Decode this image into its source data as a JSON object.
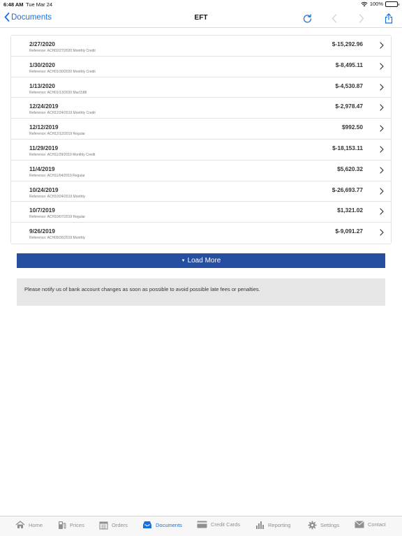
{
  "status": {
    "time": "6:48 AM",
    "date": "Tue Mar 24",
    "battery": "100%"
  },
  "nav": {
    "back_label": "Documents",
    "title": "EFT"
  },
  "rows": [
    {
      "date": "2/27/2020",
      "reference": "Reference: ACH02/27/2020 Monthly Credit",
      "amount": "$-15,292.96"
    },
    {
      "date": "1/30/2020",
      "reference": "Reference: ACH01/30/2020 Monthly Credit",
      "amount": "$-8,495.11"
    },
    {
      "date": "1/13/2020",
      "reference": "Reference: ACH01/13/2020 Mar1588",
      "amount": "$-4,530.87"
    },
    {
      "date": "12/24/2019",
      "reference": "Reference: ACH12/24/2019 Monthly Credit",
      "amount": "$-2,978.47"
    },
    {
      "date": "12/12/2019",
      "reference": "Reference: ACH12/12/2019 Regular",
      "amount": "$992.50"
    },
    {
      "date": "11/29/2019",
      "reference": "Reference: ACH11/29/2019 Monthly Credit",
      "amount": "$-18,153.11"
    },
    {
      "date": "11/4/2019",
      "reference": "Reference: ACH11/04/2019 Regular",
      "amount": "$5,620.32"
    },
    {
      "date": "10/24/2019",
      "reference": "Reference: ACH10/24/2019 Monthly",
      "amount": "$-26,693.77"
    },
    {
      "date": "10/7/2019",
      "reference": "Reference: ACH10/07/2019 Regular",
      "amount": "$1,321.02"
    },
    {
      "date": "9/26/2019",
      "reference": "Reference: ACH09/26/2019 Monthly",
      "amount": "$-9,091.27"
    }
  ],
  "load_more_label": "Load More",
  "notice": "Please notify us of bank account changes as soon as possible to avoid possible late fees or penalties.",
  "tabs": [
    {
      "label": "Home",
      "icon": "home-icon"
    },
    {
      "label": "Prices",
      "icon": "fuel-pump-icon"
    },
    {
      "label": "Orders",
      "icon": "calendar-icon"
    },
    {
      "label": "Documents",
      "icon": "inbox-icon",
      "active": true
    },
    {
      "label": "Credit Cards",
      "icon": "credit-card-icon"
    },
    {
      "label": "Reporting",
      "icon": "bar-chart-icon"
    },
    {
      "label": "Settings",
      "icon": "gear-icon"
    },
    {
      "label": "Contact",
      "icon": "envelope-icon"
    }
  ],
  "colors": {
    "accent": "#1a6fe0",
    "load_more_bg": "#264ea0",
    "notice_bg": "#e6e6e6",
    "tab_inactive": "#8f8f8f"
  }
}
